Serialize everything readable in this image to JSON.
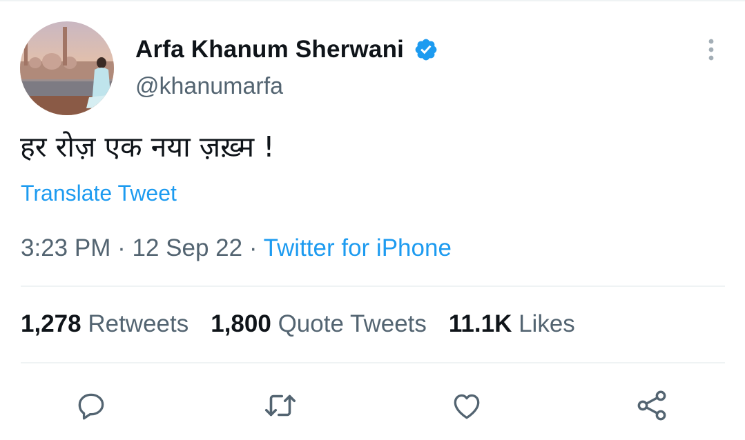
{
  "user": {
    "display_name": "Arfa Khanum Sherwani",
    "handle": "@khanumarfa",
    "verified": true
  },
  "tweet": {
    "text": "हर रोज़ एक नया ज़ख़्म !",
    "translate_label": "Translate Tweet",
    "time": "3:23 PM",
    "separator": "·",
    "date": "12 Sep 22",
    "source": "Twitter for iPhone"
  },
  "stats": [
    {
      "count": "1,278",
      "label": "Retweets"
    },
    {
      "count": "1,800",
      "label": "Quote Tweets"
    },
    {
      "count": "11.1K",
      "label": "Likes"
    }
  ],
  "actions": [
    "reply-icon",
    "retweet-icon",
    "like-icon",
    "share-icon"
  ],
  "colors": {
    "accent": "#1d9bf0",
    "text": "#0f1419",
    "secondary": "#536471",
    "divider": "#eff3f4"
  }
}
